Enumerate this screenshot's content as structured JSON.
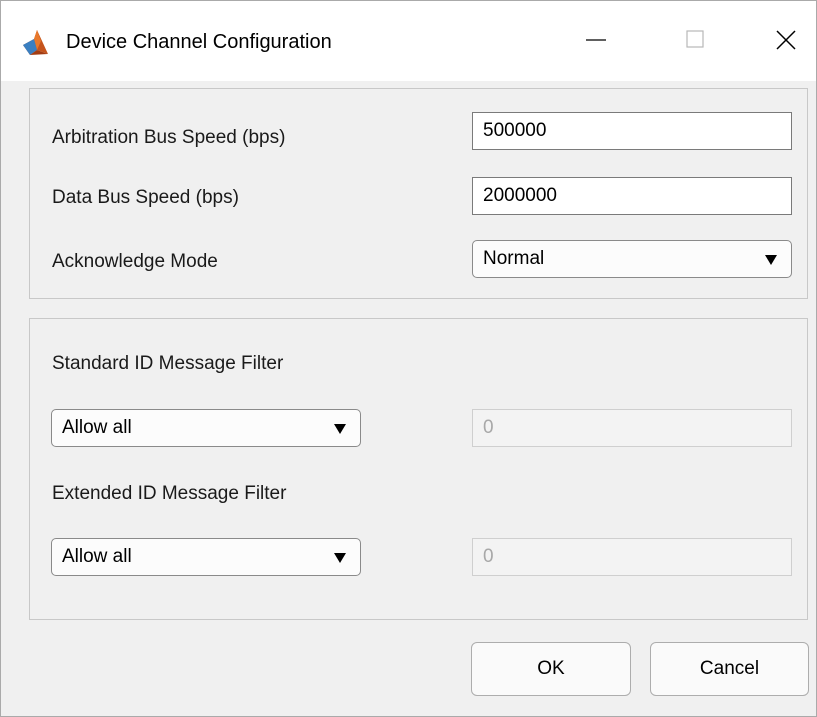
{
  "window": {
    "title": "Device Channel Configuration",
    "app_icon": "matlab-logo-icon",
    "controls": [
      "minimize-icon",
      "maximize-icon",
      "close-icon"
    ]
  },
  "speed_panel": {
    "arbitration_label": "Arbitration Bus Speed (bps)",
    "arbitration_value": "500000",
    "data_label": "Data Bus Speed (bps)",
    "data_value": "2000000",
    "ack_label": "Acknowledge Mode",
    "ack_value": "Normal"
  },
  "filter_panel": {
    "standard_label": "Standard ID Message Filter",
    "standard_mode": "Allow all",
    "standard_value": "0",
    "extended_label": "Extended ID Message Filter",
    "extended_mode": "Allow all",
    "extended_value": "0"
  },
  "buttons": {
    "ok_label": "OK",
    "cancel_label": "Cancel"
  }
}
